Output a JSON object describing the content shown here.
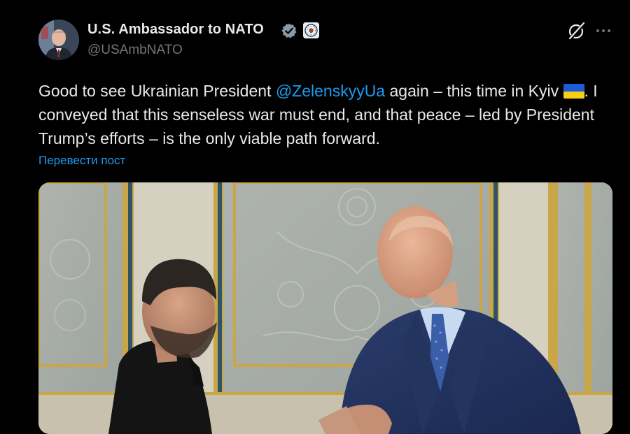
{
  "author": {
    "display_name": "U.S. Ambassador to NATO",
    "handle": "@USAmbNATO",
    "verified_badge_icon": "verified-check-icon",
    "affiliation_icon": "us-state-department-seal-icon"
  },
  "actions": {
    "grok_icon": "grok-slash-icon",
    "more_icon": "more-dots-icon"
  },
  "tweet": {
    "text_before_mention": "Good to see Ukrainian President ",
    "mention": "@ZelenskyyUa",
    "text_after_mention": " again – this time in Kyiv ",
    "flag_emoji": "ukraine-flag",
    "text_after_flag": ". I conveyed that this senseless war must end, and that peace – led by President Trump’s efforts – is the only viable path forward."
  },
  "translate_link": "Перевести пост",
  "colors": {
    "background": "#000000",
    "text": "#e7e9ea",
    "secondary_text": "#71767b",
    "link": "#1d9bf0",
    "verified": "#8b98a5",
    "flag_blue": "#1f5bd8",
    "flag_yellow": "#f5cf13"
  }
}
